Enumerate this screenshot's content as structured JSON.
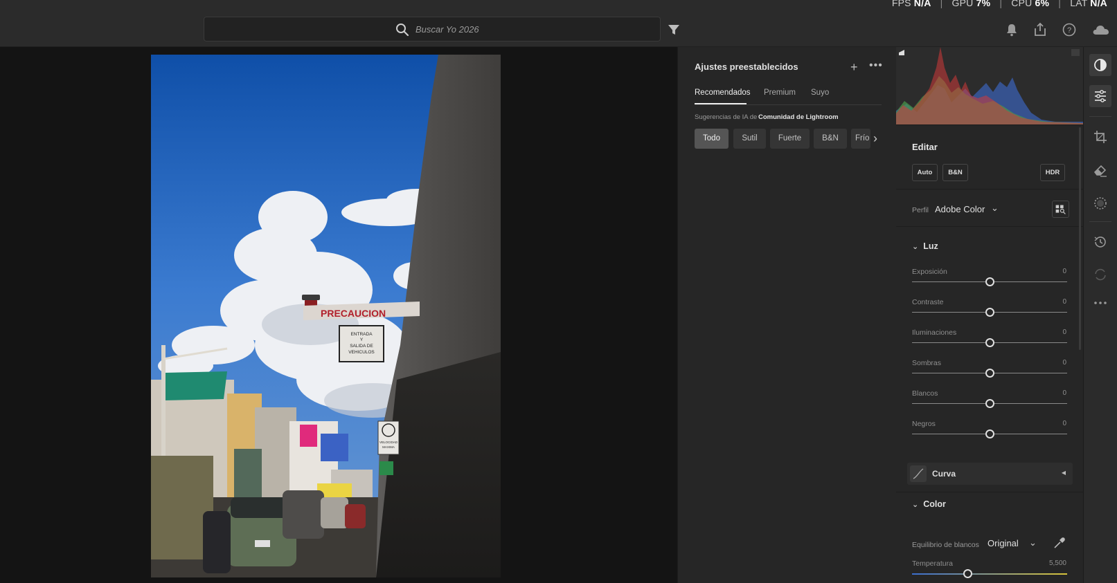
{
  "perf": {
    "fps_label": "FPS",
    "fps_value": "N/A",
    "gpu_label": "GPU",
    "gpu_value": "7%",
    "cpu_label": "CPU",
    "cpu_value": "6%",
    "lat_label": "LAT",
    "lat_value": "N/A",
    "separator": "|"
  },
  "search": {
    "placeholder": "Buscar Yo 2026"
  },
  "top_icons": [
    "filter-icon",
    "bell-icon",
    "share-icon",
    "help-icon",
    "cloud-icon"
  ],
  "photo": {
    "sign_main": "PRECAUCION",
    "sign_sub": [
      "ENTRADA",
      "Y",
      "SALIDA DE",
      "VEHICULOS"
    ],
    "sign_side": [
      "VELOCIDAD",
      "MAXIMA"
    ]
  },
  "presets": {
    "title": "Ajustes preestablecidos",
    "add_icon": "+",
    "more_icon": "•••",
    "tabs": [
      {
        "label": "Recomendados",
        "active": true
      },
      {
        "label": "Premium",
        "active": false
      },
      {
        "label": "Suyo",
        "active": false
      }
    ],
    "ai_prefix": "Sugerencias de IA de",
    "ai_source": "Comunidad de Lightroom",
    "chips": [
      {
        "label": "Todo",
        "active": true
      },
      {
        "label": "Sutil",
        "active": false
      },
      {
        "label": "Fuerte",
        "active": false
      },
      {
        "label": "B&N",
        "active": false
      },
      {
        "label": "Frío",
        "active": false
      }
    ]
  },
  "edit": {
    "title": "Editar",
    "buttons": [
      "Auto",
      "B&N",
      "HDR"
    ],
    "profile_label": "Perfil",
    "profile_value": "Adobe Color",
    "light": {
      "title": "Luz",
      "sliders": [
        {
          "label": "Exposición",
          "value": "0",
          "position": 0.5
        },
        {
          "label": "Contraste",
          "value": "0",
          "position": 0.5
        },
        {
          "label": "Iluminaciones",
          "value": "0",
          "position": 0.5
        },
        {
          "label": "Sombras",
          "value": "0",
          "position": 0.5
        },
        {
          "label": "Blancos",
          "value": "0",
          "position": 0.5
        },
        {
          "label": "Negros",
          "value": "0",
          "position": 0.5
        }
      ]
    },
    "curve_label": "Curva",
    "color": {
      "title": "Color",
      "wb_label": "Equilibrio de blancos",
      "wb_value": "Original",
      "temp_label": "Temperatura",
      "temp_value": "5,500",
      "temp_position": 0.36
    }
  },
  "tools": [
    "edit-presets-icon",
    "adjust-icon",
    "crop-icon",
    "heal-icon",
    "mask-icon",
    "history-icon",
    "sync-icon",
    "more-icon"
  ],
  "colors": {
    "hist_red": "#d23a3a",
    "hist_green": "#4a9a4a",
    "hist_blue": "#3a5fb0",
    "temp_gradient_start": "#3b6fd0",
    "temp_gradient_end": "#d8c43a"
  }
}
